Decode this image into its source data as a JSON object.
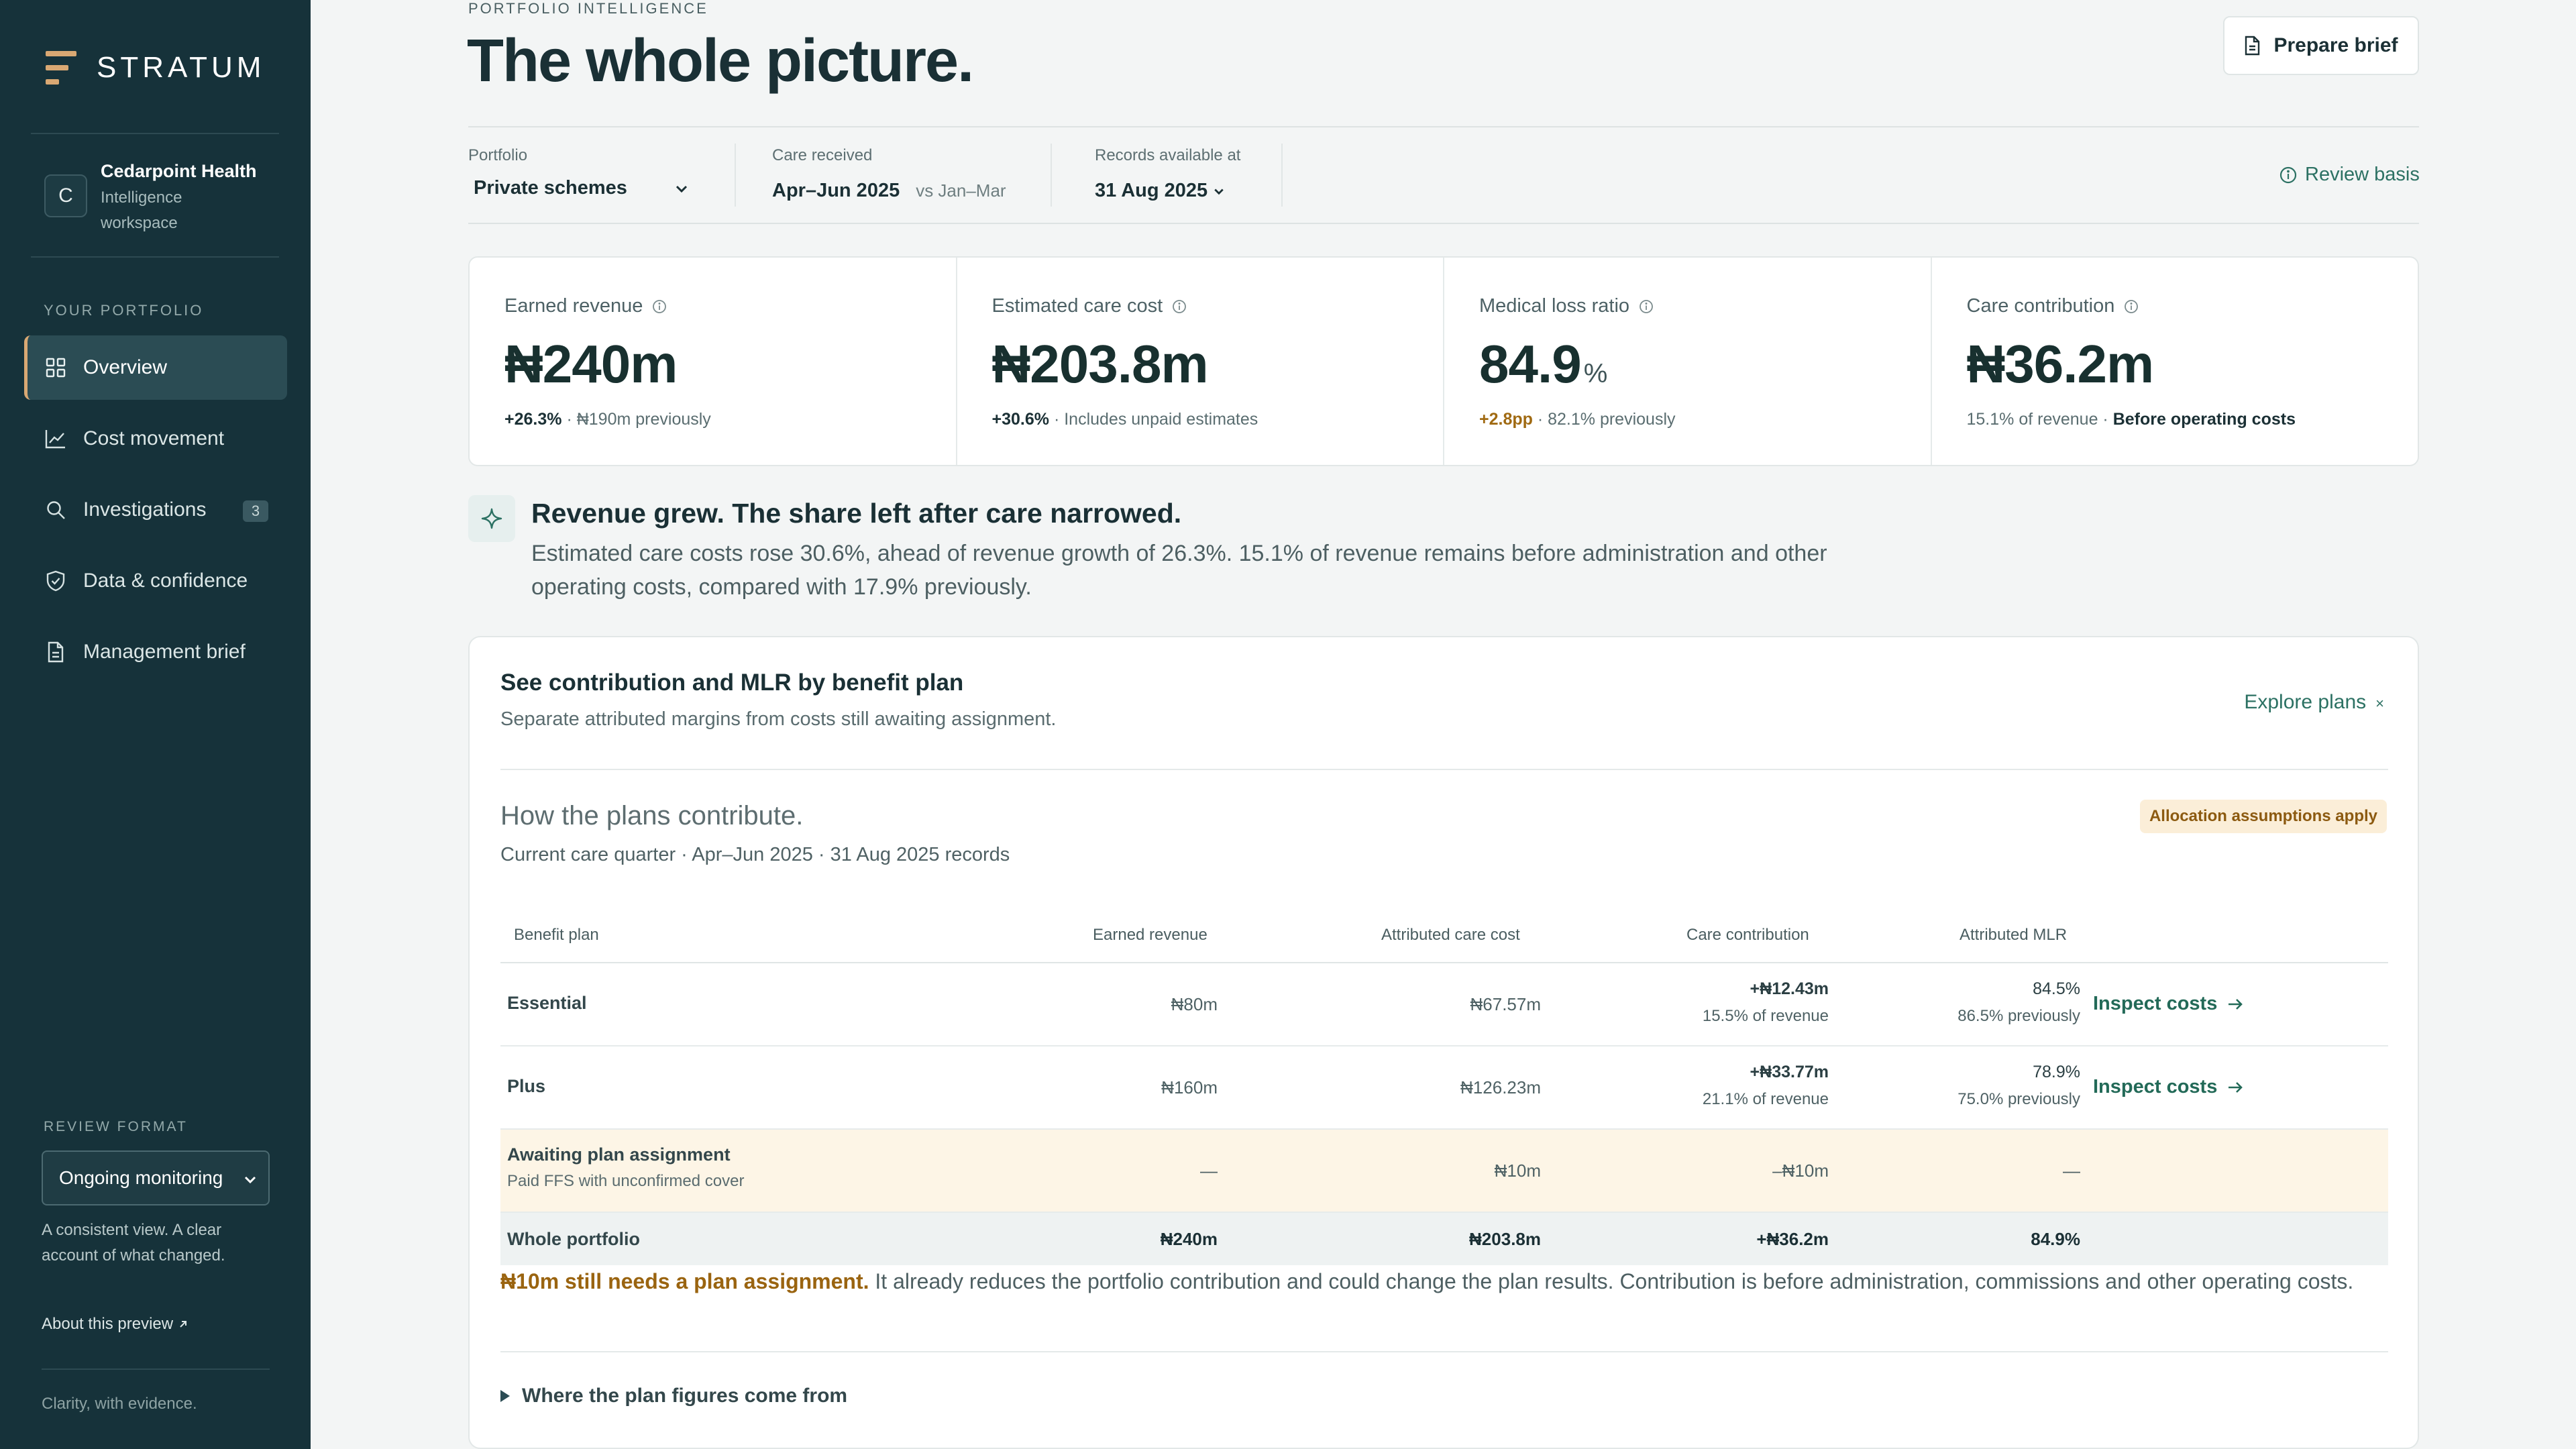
{
  "app": {
    "brand": "STRATUM",
    "accent": "#d9a873",
    "sidebar_bg": "#16323a",
    "link_color": "#2c7163"
  },
  "workspace": {
    "initial": "C",
    "name": "Cedarpoint Health",
    "subtitle_line1": "Intelligence",
    "subtitle_line2": "workspace"
  },
  "sidebar": {
    "section_label": "YOUR PORTFOLIO",
    "items": [
      {
        "label": "Overview",
        "icon": "grid-icon",
        "active": true
      },
      {
        "label": "Cost movement",
        "icon": "line-chart-icon"
      },
      {
        "label": "Investigations",
        "icon": "search-icon",
        "badge": "3"
      },
      {
        "label": "Data & confidence",
        "icon": "shield-check-icon"
      },
      {
        "label": "Management brief",
        "icon": "document-icon"
      }
    ],
    "review_format_label": "REVIEW FORMAT",
    "review_format_value": "Ongoing monitoring",
    "blurb_line1": "A consistent view. A clear",
    "blurb_line2": "account of what changed.",
    "about_link": "About this preview",
    "tagline": "Clarity, with evidence."
  },
  "header": {
    "eyebrow": "PORTFOLIO INTELLIGENCE",
    "title": "The whole picture.",
    "prepare_button": "Prepare brief"
  },
  "filters": {
    "portfolio": {
      "label": "Portfolio",
      "value": "Private schemes"
    },
    "care_received": {
      "label": "Care received",
      "value": "Apr–Jun 2025",
      "compare": "vs Jan–Mar"
    },
    "records": {
      "label": "Records available at",
      "value": "31 Aug 2025"
    },
    "review_basis": "Review basis"
  },
  "kpis": [
    {
      "label": "Earned revenue",
      "value": "₦240m",
      "unit": "",
      "delta": "+26.3%",
      "rest": " · ₦190m previously"
    },
    {
      "label": "Estimated care cost",
      "value": "₦203.8m",
      "unit": "",
      "delta": "+30.6%",
      "rest": " · Includes unpaid estimates"
    },
    {
      "label": "Medical loss ratio",
      "value": "84.9",
      "unit": "%",
      "delta": "+2.8pp",
      "rest": " · 82.1% previously"
    },
    {
      "label": "Care contribution",
      "value": "₦36.2m",
      "unit": "",
      "delta": "",
      "rest": "15.1% of revenue · ",
      "strong": "Before operating costs"
    }
  ],
  "insight": {
    "title": "Revenue grew. The share left after care narrowed.",
    "line1": "Estimated care costs rose 30.6%, ahead of revenue growth of 26.3%. 15.1% of revenue remains before administration and other",
    "line2": "operating costs, compared with 17.9% previously."
  },
  "card": {
    "title": "See contribution and MLR by benefit plan",
    "subtitle": "Separate attributed margins from costs still awaiting assignment.",
    "explore": "Explore plans",
    "section_title": "How the plans contribute.",
    "section_sub": "Current care quarter · Apr–Jun 2025 · 31 Aug 2025 records",
    "pill": "Allocation assumptions apply",
    "columns": [
      "Benefit plan",
      "Earned revenue",
      "Attributed care cost",
      "Care contribution",
      "Attributed MLR"
    ],
    "rows": [
      {
        "plan": "Essential",
        "revenue": "₦80m",
        "cost": "₦67.57m",
        "contribution": "+₦12.43m",
        "contribution_sub": "15.5% of revenue",
        "mlr": "84.5%",
        "mlr_sub": "86.5% previously",
        "action": "Inspect costs"
      },
      {
        "plan": "Plus",
        "revenue": "₦160m",
        "cost": "₦126.23m",
        "contribution": "+₦33.77m",
        "contribution_sub": "21.1% of revenue",
        "mlr": "78.9%",
        "mlr_sub": "75.0% previously",
        "action": "Inspect costs"
      }
    ],
    "awaiting": {
      "plan": "Awaiting plan assignment",
      "sub": "Paid FFS with unconfirmed cover",
      "revenue": "—",
      "cost": "₦10m",
      "contribution": "–₦10m",
      "mlr": "—"
    },
    "total": {
      "plan": "Whole portfolio",
      "revenue": "₦240m",
      "cost": "₦203.8m",
      "contribution": "+₦36.2m",
      "mlr": "84.9%"
    },
    "note_strong": "₦10m still needs a plan assignment.",
    "note_rest": " It already reduces the portfolio contribution and could change the plan results. Contribution is before administration, commissions and other operating costs.",
    "details": "Where the plan figures come from"
  }
}
